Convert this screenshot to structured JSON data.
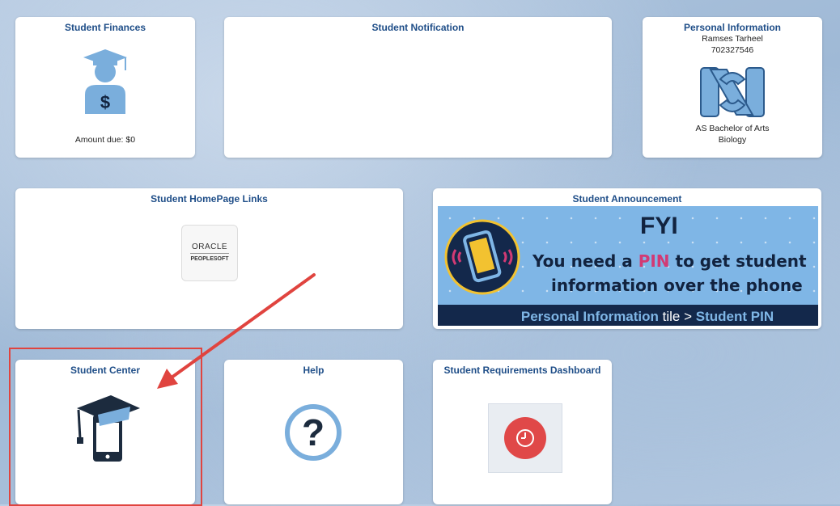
{
  "tiles": {
    "student_finances": {
      "title": "Student Finances",
      "amount_due": "Amount due: $0"
    },
    "student_notification": {
      "title": "Student Notification"
    },
    "personal_information": {
      "title": "Personal Information",
      "name": "Ramses Tarheel",
      "id": "702327546",
      "program": "AS Bachelor of Arts",
      "plan": "Biology"
    },
    "homepage_links": {
      "title": "Student HomePage Links",
      "logo_top": "ORACLE",
      "logo_bottom": "PEOPLESOFT"
    },
    "announcement": {
      "title": "Student Announcement",
      "fyi": "FYI",
      "line1_pre": "You need a ",
      "line1_pin": "PIN",
      "line1_post": " to get student",
      "line2": "information over the phone",
      "bottom_a": "Personal Information",
      "bottom_b": " tile > ",
      "bottom_c": "Student PIN"
    },
    "student_center": {
      "title": "Student Center"
    },
    "help": {
      "title": "Help"
    },
    "requirements": {
      "title": "Student Requirements Dashboard"
    }
  },
  "colors": {
    "title_blue": "#1f4e88",
    "icon_blue": "#7aaedc",
    "arrow_red": "#e0443f",
    "clock_red": "#e04848"
  }
}
